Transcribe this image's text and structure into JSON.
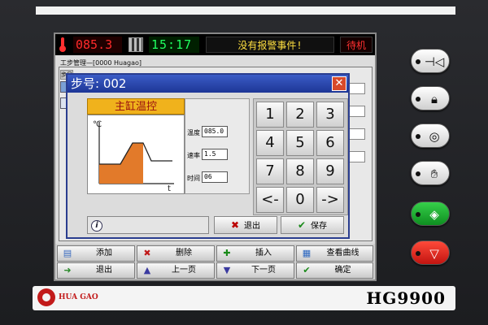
{
  "status_bar": {
    "temperature": "085.3",
    "clock": "15:17",
    "alarm_message": "没有报警事件!",
    "machine_state": "待机"
  },
  "main_window": {
    "title": "工步管理—[0000 Huagao]",
    "column_header": "步号"
  },
  "dialog": {
    "title": "步号: 002",
    "close_glyph": "✕",
    "card_title": "主缸温控",
    "graph_y_label": "℃",
    "graph_x_label": "t",
    "params": [
      {
        "label": "温度",
        "value": "085.0"
      },
      {
        "label": "速率",
        "value": "1.5"
      },
      {
        "label": "时间",
        "value": "06"
      }
    ],
    "keypad": [
      "1",
      "2",
      "3",
      "4",
      "5",
      "6",
      "7",
      "8",
      "9",
      "<-",
      "0",
      "->"
    ],
    "info_glyph": "i",
    "exit_label": "退出",
    "save_label": "保存"
  },
  "toolbar": {
    "add": "添加",
    "delete": "删除",
    "insert": "插入",
    "view_curve": "查看曲线",
    "exit": "退出",
    "prev_page": "上一页",
    "next_page": "下一页",
    "confirm": "确定"
  },
  "brand": {
    "name": "HUA GAO",
    "model": "HG9900"
  },
  "colors": {
    "title_bar": "#1d3696",
    "card_header": "#f0b21c",
    "temp_display": "#ff2a2a",
    "clock_display": "#20ff60",
    "alarm_text": "#ffe040",
    "start_button": "#0e8e20",
    "stop_button": "#c21410"
  }
}
